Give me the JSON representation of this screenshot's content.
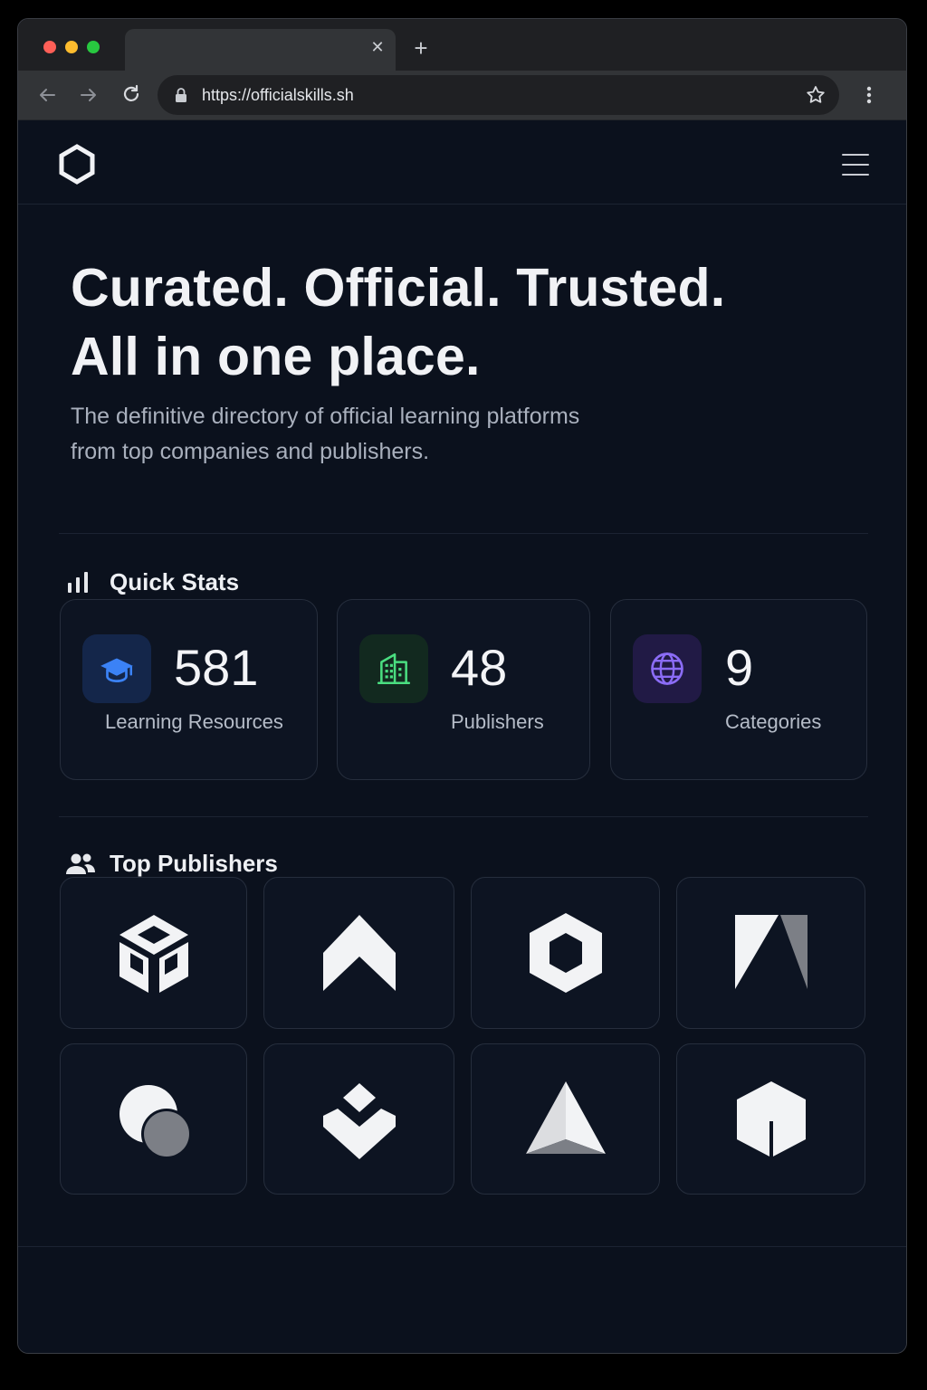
{
  "browser": {
    "traffic_lights": [
      "#ff5f57",
      "#febc2e",
      "#28c840"
    ],
    "tab": {
      "title": "",
      "close_icon": "close-icon"
    },
    "new_tab_icon": "plus-icon",
    "url": "https://officialskills.sh"
  },
  "header": {
    "logo_icon": "hexagon-logo-icon",
    "menu_icon": "hamburger-menu-icon"
  },
  "hero": {
    "title_line1": "Curated. Official. Trusted.",
    "title_line2": "All in one place.",
    "subtitle_line1": "The definitive directory of official learning platforms",
    "subtitle_line2": "from top companies and publishers."
  },
  "quick_stats": {
    "title": "Quick Stats",
    "icon": "bar-chart-icon",
    "items": [
      {
        "value": "581",
        "label": "Learning Resources",
        "icon": "graduation-cap-icon",
        "accent": "#3b82f6",
        "icon_bg": "#14264a"
      },
      {
        "value": "48",
        "label": "Publishers",
        "icon": "building-icon",
        "accent": "#4ade80",
        "icon_bg": "#12291f"
      },
      {
        "value": "9",
        "label": "Categories",
        "icon": "globe-icon",
        "accent": "#8b6cf6",
        "icon_bg": "#211a45"
      }
    ]
  },
  "top_publishers": {
    "title": "Top Publishers",
    "icon": "users-icon",
    "logos": [
      "cube-logo",
      "chevron-up-logo",
      "hexagon-logo",
      "corner-triangle-logo",
      "overlapping-circles-logo",
      "stacked-chevron-logo",
      "pyramid-logo",
      "split-hexagon-logo"
    ]
  }
}
